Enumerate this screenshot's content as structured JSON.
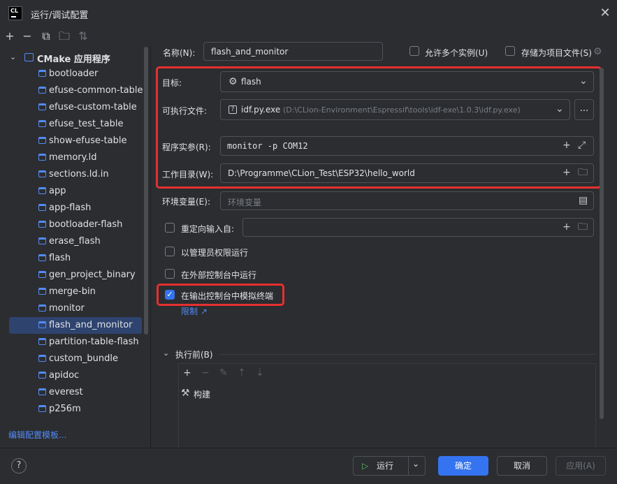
{
  "window": {
    "title": "运行/调试配置",
    "logo": "CL"
  },
  "sidebar": {
    "root_label": "CMake 应用程序",
    "items": [
      "bootloader",
      "efuse-common-table",
      "efuse-custom-table",
      "efuse_test_table",
      "show-efuse-table",
      "memory.ld",
      "sections.ld.in",
      "app",
      "app-flash",
      "bootloader-flash",
      "erase_flash",
      "flash",
      "gen_project_binary",
      "merge-bin",
      "monitor",
      "flash_and_monitor",
      "partition-table-flash",
      "custom_bundle",
      "apidoc",
      "everest",
      "p256m"
    ],
    "selected_index": 15,
    "edit_template": "编辑配置模板..."
  },
  "form": {
    "name_label": "名称(N):",
    "name_value": "flash_and_monitor",
    "allow_multiple": "允许多个实例(U)",
    "store_as_file": "存储为项目文件(S)",
    "target_label": "目标:",
    "target_value": "flash",
    "executable_label": "可执行文件:",
    "executable_value": "idf.py.exe",
    "executable_path": "(D:\\CLion-Environment\\Espressif\\tools\\idf-exe\\1.0.3\\idf.py.exe)",
    "browse_label": "...",
    "args_label": "程序实参(R):",
    "args_value": "monitor -p COM12",
    "workdir_label": "工作目录(W):",
    "workdir_value": "D:\\Programme\\CLion_Test\\ESP32\\hello_world",
    "env_label": "环境变量(E):",
    "env_placeholder": "环境变量",
    "redirect_label": "重定向输入自:",
    "admin_label": "以管理员权限运行",
    "external_console_label": "在外部控制台中运行",
    "emulate_terminal_label": "在输出控制台中模拟终端",
    "limit_link": "限制",
    "before_run_label": "执行前(B)",
    "build_task": "构建"
  },
  "buttons": {
    "run": "运行",
    "ok": "确定",
    "cancel": "取消",
    "apply": "应用(A)",
    "help": "?"
  },
  "colors": {
    "accent": "#3574f0",
    "highlight": "#e5302f",
    "selection": "#2e436e"
  }
}
